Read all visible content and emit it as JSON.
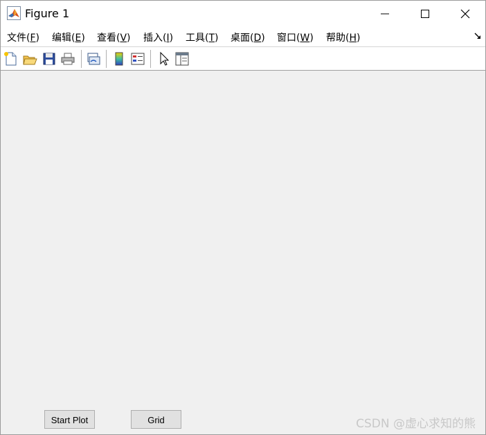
{
  "window": {
    "title": "Figure 1",
    "app_icon": "matlab-icon"
  },
  "menu": {
    "items": [
      {
        "label": "文件(",
        "key": "F",
        "end": ")"
      },
      {
        "label": "编辑(",
        "key": "E",
        "end": ")"
      },
      {
        "label": "查看(",
        "key": "V",
        "end": ")"
      },
      {
        "label": "插入(",
        "key": "I",
        "end": ")"
      },
      {
        "label": "工具(",
        "key": "T",
        "end": ")"
      },
      {
        "label": "桌面(",
        "key": "D",
        "end": ")"
      },
      {
        "label": "窗口(",
        "key": "W",
        "end": ")"
      },
      {
        "label": "帮助(",
        "key": "H",
        "end": ")"
      }
    ]
  },
  "toolbar": {
    "icons": [
      "new-figure-icon",
      "open-file-icon",
      "save-icon",
      "print-icon",
      "link-plot-icon",
      "insert-colorbar-icon",
      "insert-legend-icon",
      "edit-plot-icon",
      "property-inspector-icon"
    ]
  },
  "controls": {
    "start_plot_label": "Start Plot",
    "grid_label": "Grid"
  },
  "watermark": {
    "text": "CSDN @虚心求知的熊"
  },
  "colors": {
    "figure_background": "#f0f0f0",
    "button_face": "#e1e1e1"
  }
}
